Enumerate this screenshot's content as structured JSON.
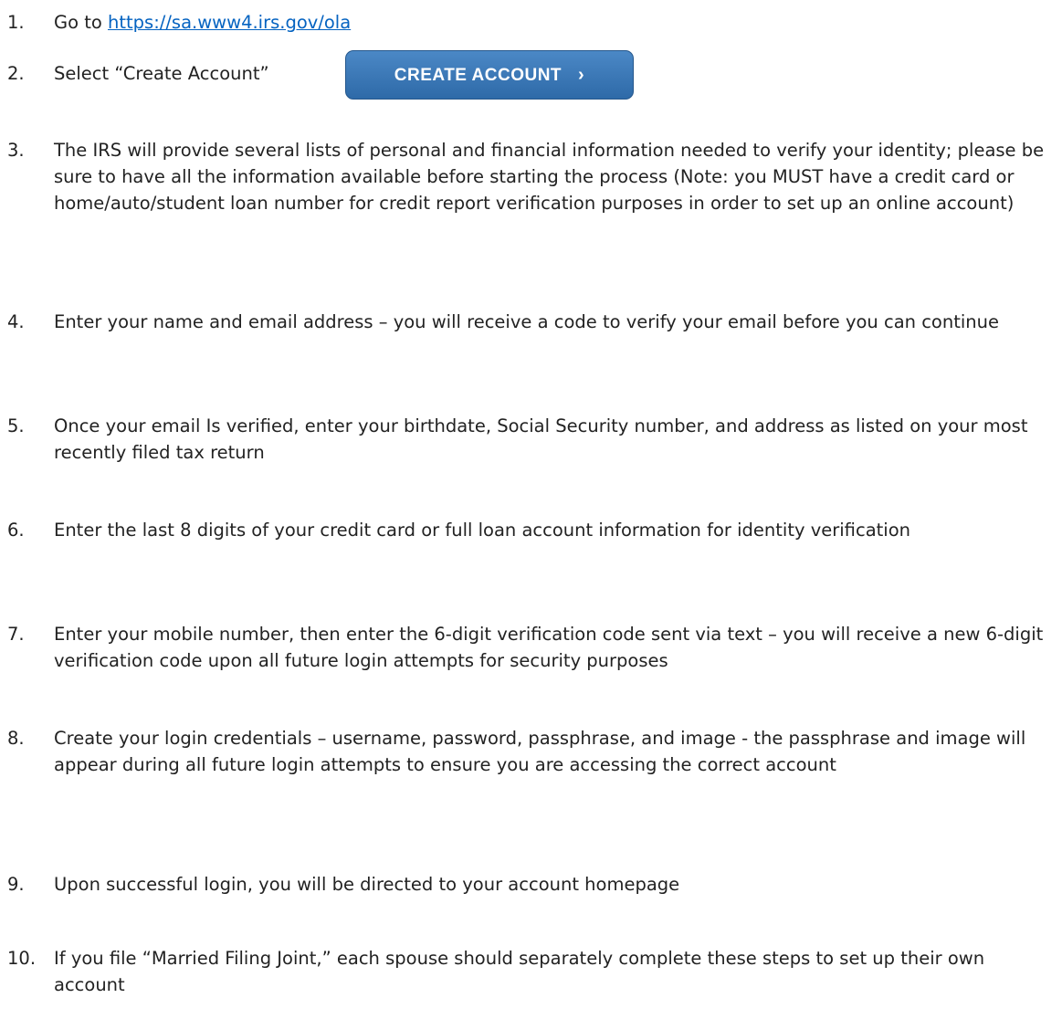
{
  "steps": [
    {
      "number": "1.",
      "text": "Go to ",
      "link": "https://sa.www4.irs.gov/ola"
    },
    {
      "number": "2.",
      "text": "Select “Create Account”"
    },
    {
      "number": "3.",
      "text": "The IRS will provide several lists of personal and financial information needed to verify your identity; please be sure to have all the information available before starting the process (Note: you MUST have a credit card or home/auto/student loan number for credit report verification purposes in order to set up an online account)"
    },
    {
      "number": "4.",
      "text": "Enter your name and email address – you will receive a code to verify your email before you can continue"
    },
    {
      "number": "5.",
      "text": "Once your email Is verified, enter your birthdate, Social Security number, and address as listed on your most recently filed tax return"
    },
    {
      "number": "6.",
      "text": "Enter the last 8 digits of your credit card or full loan account information for identity verification"
    },
    {
      "number": "7.",
      "text": "Enter your mobile number, then enter the 6-digit verification code sent via text – you will receive a new 6-digit verification code upon all future login attempts for security purposes"
    },
    {
      "number": "8.",
      "text": "Create your login credentials – username, password, passphrase, and image - the passphrase and image will appear during all future login attempts to ensure you are accessing the correct account"
    },
    {
      "number": "9.",
      "text": "Upon successful login, you will be directed to your account homepage"
    },
    {
      "number": "10.",
      "text": "If you file “Married Filing Joint,” each spouse should separately complete these steps to set up their own account"
    }
  ],
  "create_account_button": {
    "label": "CREATE ACCOUNT",
    "icon": "chevron-right-icon"
  }
}
